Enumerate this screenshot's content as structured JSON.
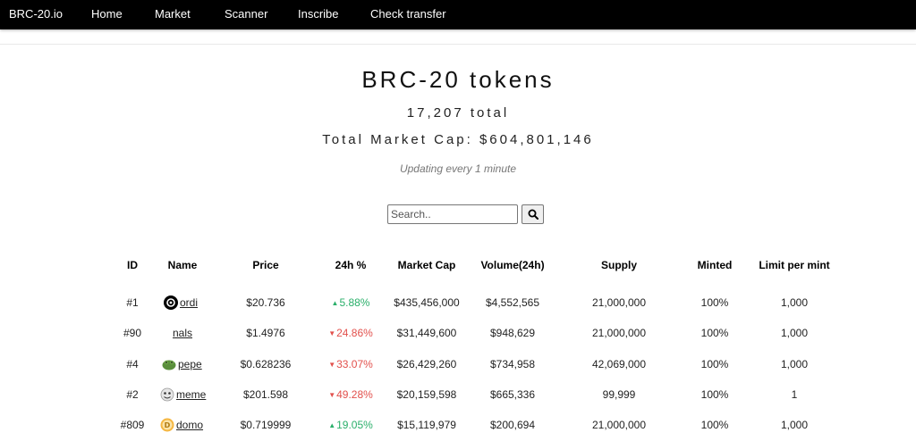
{
  "nav": {
    "brand": "BRC-20.io",
    "links": [
      "Home",
      "Market",
      "Scanner",
      "Inscribe",
      "Check transfer"
    ]
  },
  "header": {
    "title": "BRC-20 tokens",
    "total": "17,207 total",
    "market_cap": "Total Market Cap: $604,801,146",
    "update_note": "Updating every 1 minute"
  },
  "search": {
    "placeholder": "Search..",
    "icon": "search-icon"
  },
  "table": {
    "headers": [
      "ID",
      "Name",
      "Price",
      "24h %",
      "Market Cap",
      "Volume(24h)",
      "Supply",
      "Minted",
      "Limit per mint"
    ],
    "rows": [
      {
        "id": "#1",
        "name": "ordi",
        "icon": "ordi-token-icon",
        "price": "$20.736",
        "change": "5.88%",
        "direction": "up",
        "market_cap": "$435,456,000",
        "volume": "$4,552,565",
        "supply": "21,000,000",
        "minted": "100%",
        "limit": "1,000"
      },
      {
        "id": "#90",
        "name": "nals",
        "icon": "",
        "price": "$1.4976",
        "change": "24.86%",
        "direction": "down",
        "market_cap": "$31,449,600",
        "volume": "$948,629",
        "supply": "21,000,000",
        "minted": "100%",
        "limit": "1,000"
      },
      {
        "id": "#4",
        "name": "pepe",
        "icon": "pepe-token-icon",
        "price": "$0.628236",
        "change": "33.07%",
        "direction": "down",
        "market_cap": "$26,429,260",
        "volume": "$734,958",
        "supply": "42,069,000",
        "minted": "100%",
        "limit": "1,000"
      },
      {
        "id": "#2",
        "name": "meme",
        "icon": "meme-token-icon",
        "price": "$201.598",
        "change": "49.28%",
        "direction": "down",
        "market_cap": "$20,159,598",
        "volume": "$665,336",
        "supply": "99,999",
        "minted": "100%",
        "limit": "1"
      },
      {
        "id": "#809",
        "name": "domo",
        "icon": "domo-token-icon",
        "price": "$0.719999",
        "change": "19.05%",
        "direction": "up",
        "market_cap": "$15,119,979",
        "volume": "$200,694",
        "supply": "21,000,000",
        "minted": "100%",
        "limit": "1,000"
      }
    ]
  },
  "colors": {
    "up": "#2aaf6a",
    "down": "#e2504c",
    "navbar": "#000000"
  }
}
